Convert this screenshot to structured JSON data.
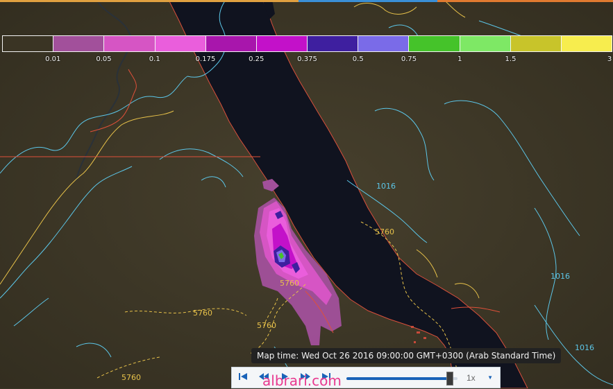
{
  "legend": {
    "swatches": [
      {
        "color": "#3a3424"
      },
      {
        "color": "#a2509b"
      },
      {
        "color": "#d655c4"
      },
      {
        "color": "#ea5edc"
      },
      {
        "color": "#a816ac"
      },
      {
        "color": "#c311c9"
      },
      {
        "color": "#3e1f9f"
      },
      {
        "color": "#7a6be8"
      },
      {
        "color": "#45c32a"
      },
      {
        "color": "#7ee865"
      },
      {
        "color": "#c8c42a"
      },
      {
        "color": "#f7ed4e"
      }
    ],
    "ticks": [
      "0.01",
      "0.05",
      "0.1",
      "0.175",
      "0.25",
      "0.375",
      "0.5",
      "0.75",
      "1",
      "1.5",
      "3"
    ]
  },
  "contour_labels": [
    {
      "text": "1016",
      "kind": "pressure"
    },
    {
      "text": "1016",
      "kind": "pressure"
    },
    {
      "text": "1016",
      "kind": "pressure"
    },
    {
      "text": "5760",
      "kind": "height"
    },
    {
      "text": "5760",
      "kind": "height"
    },
    {
      "text": "5760",
      "kind": "height"
    },
    {
      "text": "5760",
      "kind": "height"
    },
    {
      "text": "5760",
      "kind": "height"
    }
  ],
  "map_time": "Map time: Wed Oct 26 2016 09:00:00 GMT+0300 (Arab Standard Time)",
  "controls": {
    "first_icon": "skip-first-icon",
    "rewind_icon": "rewind-icon",
    "play_icon": "play-icon",
    "forward_icon": "fast-forward-icon",
    "last_icon": "skip-last-icon",
    "timeline_position": 0.93,
    "speed": "1x"
  },
  "watermark": "albrari.com",
  "colors": {
    "land": "#3a3526",
    "sea": "#0f1320",
    "coast": "#e0503a",
    "pressure_contour": "#5cc6e8",
    "height_contour": "#e8c24a",
    "border": "#e0503a",
    "accent": "#1a63b8"
  }
}
